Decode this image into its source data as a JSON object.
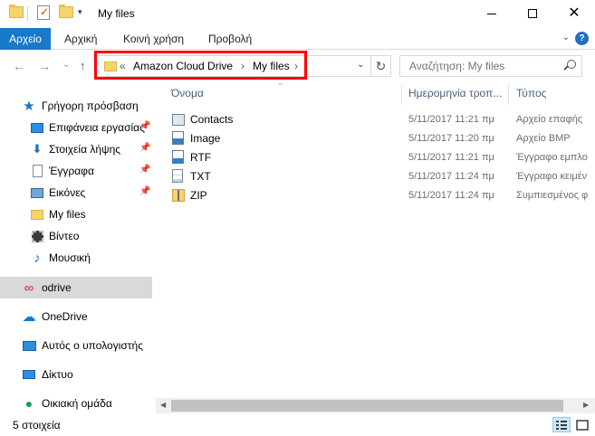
{
  "window": {
    "title": "My files",
    "quick_access_dropdown": "▾",
    "minimize": "",
    "maximize": "",
    "close": "✕"
  },
  "ribbon": {
    "tabs": [
      "Αρχείο",
      "Αρχική",
      "Κοινή χρήση",
      "Προβολή"
    ],
    "expand_glyph": "⌄",
    "help_glyph": "?"
  },
  "address_bar": {
    "overflow": "«",
    "crumbs": [
      "Amazon Cloud Drive",
      "My files"
    ],
    "separator": "›",
    "dropdown_glyph": "⌄",
    "refresh_glyph": "↻"
  },
  "nav_buttons": {
    "back": "←",
    "forward": "→",
    "recent": "⌄",
    "up": "↑"
  },
  "search": {
    "placeholder": "Αναζήτηση: My files"
  },
  "nav_pane": {
    "items": [
      {
        "label": "Γρήγορη πρόσβαση",
        "icon": "star-icon",
        "pinned": false,
        "selected": false
      },
      {
        "label": "Επιφάνεια εργασίας",
        "icon": "desktop-icon",
        "pinned": true,
        "selected": false
      },
      {
        "label": "Στοιχεία λήψης",
        "icon": "downloads-icon",
        "pinned": true,
        "selected": false
      },
      {
        "label": "Έγγραφα",
        "icon": "documents-icon",
        "pinned": true,
        "selected": false
      },
      {
        "label": "Εικόνες",
        "icon": "pictures-icon",
        "pinned": true,
        "selected": false
      },
      {
        "label": "My files",
        "icon": "folder-icon",
        "pinned": false,
        "selected": false
      },
      {
        "label": "Βίντεο",
        "icon": "videos-icon",
        "pinned": false,
        "selected": false
      },
      {
        "label": "Μουσική",
        "icon": "music-icon",
        "pinned": false,
        "selected": false
      },
      {
        "label": "odrive",
        "icon": "odrive-icon",
        "pinned": false,
        "selected": true
      },
      {
        "label": "OneDrive",
        "icon": "onedrive-icon",
        "pinned": false,
        "selected": false
      },
      {
        "label": "Αυτός ο υπολογιστής",
        "icon": "computer-icon",
        "pinned": false,
        "selected": false
      },
      {
        "label": "Δίκτυο",
        "icon": "network-icon",
        "pinned": false,
        "selected": false
      },
      {
        "label": "Οικιακή ομάδα",
        "icon": "homegroup-icon",
        "pinned": false,
        "selected": false
      }
    ]
  },
  "file_list": {
    "columns": [
      "Όνομα",
      "Ημερομηνία τροπ...",
      "Τύπος"
    ],
    "sort_glyph": "^",
    "rows": [
      {
        "name": "Contacts",
        "date": "5/11/2017 11:21 πμ",
        "type": "Αρχείο επαφής",
        "icon": "contacts-file-icon"
      },
      {
        "name": "Image",
        "date": "5/11/2017 11:20 πμ",
        "type": "Αρχείο BMP",
        "icon": "image-file-icon"
      },
      {
        "name": "RTF",
        "date": "5/11/2017 11:21 πμ",
        "type": "Έγγραφο εμπλο",
        "icon": "rtf-file-icon"
      },
      {
        "name": "TXT",
        "date": "5/11/2017 11:24 πμ",
        "type": "Έγγραφο κειμέν",
        "icon": "txt-file-icon"
      },
      {
        "name": "ZIP",
        "date": "5/11/2017 11:24 πμ",
        "type": "Συμπιεσμένος φ",
        "icon": "zip-file-icon"
      }
    ]
  },
  "scrollbar": {
    "left_arrow": "◀",
    "right_arrow": "▶"
  },
  "status_bar": {
    "item_count": "5 στοιχεία"
  },
  "colors": {
    "file_tab_bg": "#1979ca",
    "highlight_box": "#ff0000",
    "selected_nav_bg": "#d9d9d9",
    "column_header_text": "#4c607a"
  }
}
